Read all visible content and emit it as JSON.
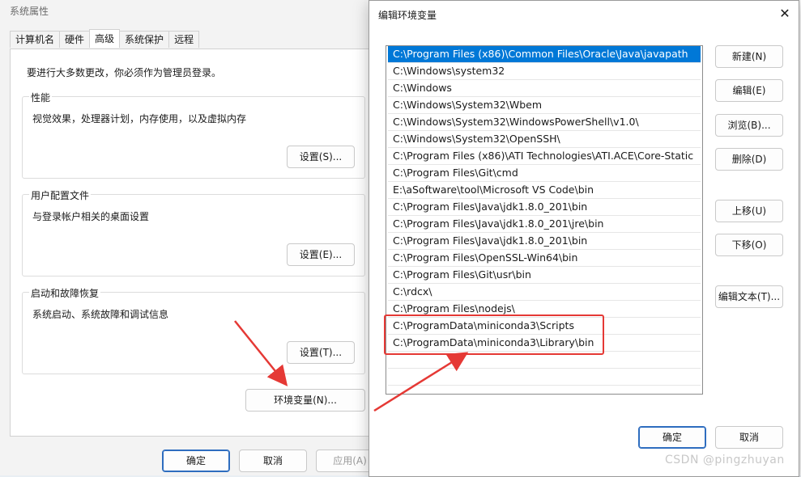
{
  "system_properties": {
    "title": "系统属性",
    "tabs": [
      "计算机名",
      "硬件",
      "高级",
      "系统保护",
      "远程"
    ],
    "admin_note": "要进行大多数更改，你必须作为管理员登录。",
    "performance": {
      "title": "性能",
      "desc": "视觉效果，处理器计划，内存使用，以及虚拟内存",
      "button": "设置(S)..."
    },
    "user_profiles": {
      "title": "用户配置文件",
      "desc": "与登录帐户相关的桌面设置",
      "button": "设置(E)..."
    },
    "startup_recovery": {
      "title": "启动和故障恢复",
      "desc": "系统启动、系统故障和调试信息",
      "button": "设置(T)..."
    },
    "env_button": "环境变量(N)...",
    "footer": {
      "ok": "确定",
      "cancel": "取消",
      "apply": "应用(A)"
    }
  },
  "dialog": {
    "title": "编辑环境变量",
    "close_icon": "close-icon",
    "paths": [
      "C:\\Program Files (x86)\\Common Files\\Oracle\\Java\\javapath",
      "C:\\Windows\\system32",
      "C:\\Windows",
      "C:\\Windows\\System32\\Wbem",
      "C:\\Windows\\System32\\WindowsPowerShell\\v1.0\\",
      "C:\\Windows\\System32\\OpenSSH\\",
      "C:\\Program Files (x86)\\ATI Technologies\\ATI.ACE\\Core-Static",
      "C:\\Program Files\\Git\\cmd",
      "E:\\aSoftware\\tool\\Microsoft VS Code\\bin",
      "C:\\Program Files\\Java\\jdk1.8.0_201\\bin",
      "C:\\Program Files\\Java\\jdk1.8.0_201\\jre\\bin",
      "C:\\Program Files\\Java\\jdk1.8.0_201\\bin",
      "C:\\Program Files\\OpenSSL-Win64\\bin",
      "C:\\Program Files\\Git\\usr\\bin",
      "C:\\rdcx\\",
      "C:\\Program Files\\nodejs\\",
      "C:\\ProgramData\\miniconda3\\Scripts",
      "C:\\ProgramData\\miniconda3\\Library\\bin"
    ],
    "buttons": {
      "new": "新建(N)",
      "edit": "编辑(E)",
      "browse": "浏览(B)...",
      "delete": "删除(D)",
      "move_up": "上移(U)",
      "move_down": "下移(O)",
      "edit_text": "编辑文本(T)..."
    },
    "ok": "确定",
    "cancel": "取消"
  },
  "watermark": "CSDN @pingzhuyan",
  "colors": {
    "selection": "#0078d7",
    "annotation": "#e53935"
  }
}
